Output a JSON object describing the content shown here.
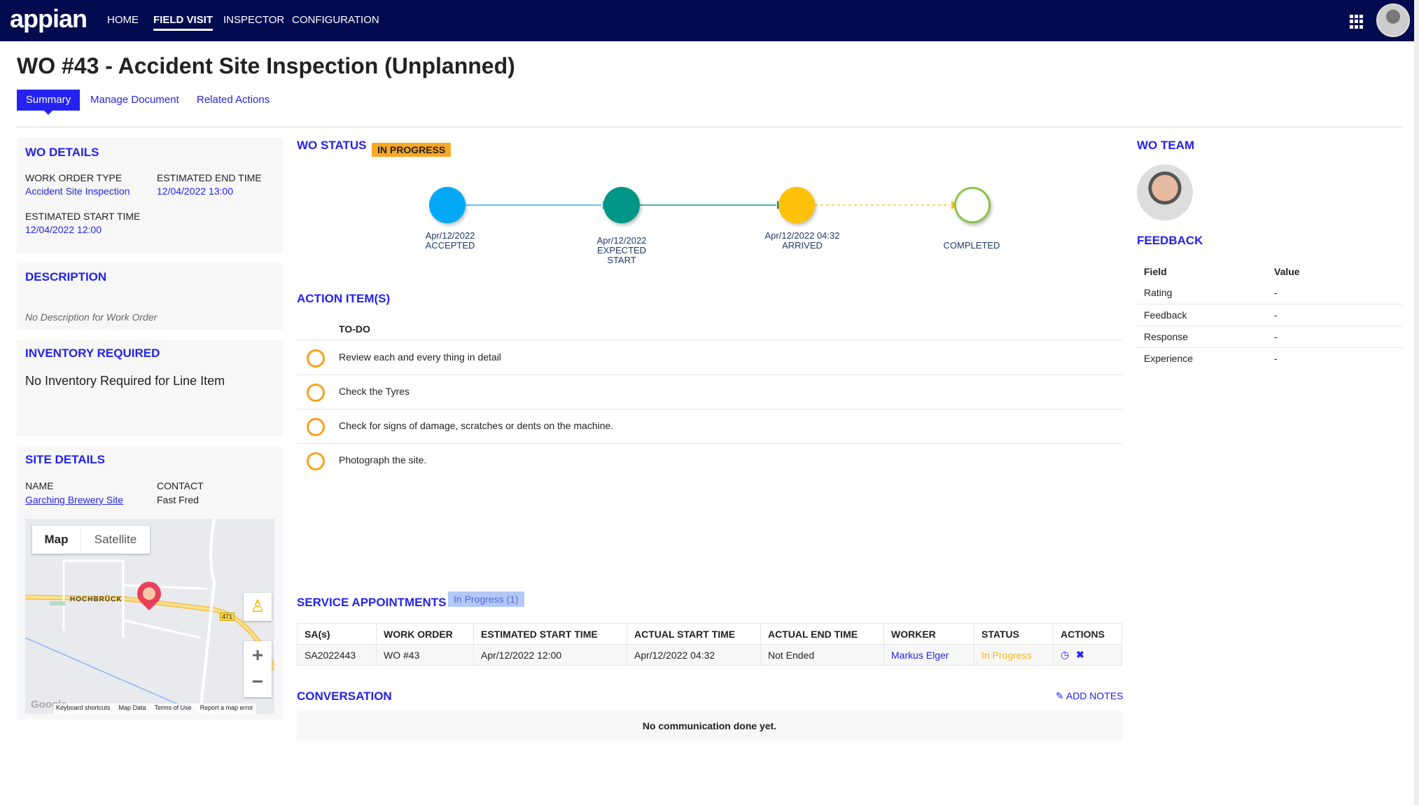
{
  "header": {
    "logo": "appian",
    "nav": [
      "HOME",
      "FIELD VISIT",
      "INSPECTOR",
      "CONFIGURATION"
    ],
    "active_nav": "FIELD VISIT"
  },
  "page": {
    "title": "WO #43 - Accident Site Inspection (Unplanned)",
    "tabs": [
      "Summary",
      "Manage Document",
      "Related Actions"
    ]
  },
  "wo_details": {
    "heading": "WO DETAILS",
    "work_order_type_label": "WORK ORDER TYPE",
    "work_order_type": "Accident Site Inspection",
    "est_end_label": "ESTIMATED END TIME",
    "est_end": "12/04/2022 13:00",
    "est_start_label": "ESTIMATED START TIME",
    "est_start": "12/04/2022 12:00"
  },
  "description": {
    "heading": "DESCRIPTION",
    "text": "No Description for Work Order"
  },
  "inventory": {
    "heading": "INVENTORY REQUIRED",
    "text": "No Inventory Required for Line Item"
  },
  "site": {
    "heading": "SITE DETAILS",
    "name_label": "NAME",
    "name": "Garching Brewery Site",
    "contact_label": "CONTACT",
    "contact": "Fast Fred",
    "map": {
      "map_btn": "Map",
      "satellite_btn": "Satellite",
      "place": "HOCHBRÜCK",
      "road": "471",
      "google": "Google",
      "footer": [
        "Keyboard shortcuts",
        "Map Data",
        "Terms of Use",
        "Report a map error"
      ]
    }
  },
  "status": {
    "heading": "WO STATUS",
    "badge": "IN PROGRESS",
    "badge_color": "#f9a825",
    "steps": [
      {
        "date": "Apr/12/2022",
        "label": "ACCEPTED",
        "color": "#03a9f4"
      },
      {
        "date": "Apr/12/2022",
        "label": "EXPECTED START",
        "color": "#009688"
      },
      {
        "date": "Apr/12/2022 04:32",
        "label": "ARRIVED",
        "color": "#ffc107"
      },
      {
        "date": "",
        "label": "COMPLETED",
        "color": "#ffffff"
      }
    ]
  },
  "actions": {
    "heading": "ACTION ITEM(S)",
    "column": "TO-DO",
    "items": [
      "Review each and every thing in detail",
      "Check the Tyres",
      "Check for signs of damage, scratches or dents on the machine.",
      "Photograph the site."
    ]
  },
  "service": {
    "heading": "SERVICE APPOINTMENTS",
    "badge": "In Progress (1)",
    "columns": [
      "SA(s)",
      "WORK ORDER",
      "ESTIMATED START TIME",
      "ACTUAL START TIME",
      "ACTUAL END TIME",
      "WORKER",
      "STATUS",
      "ACTIONS"
    ],
    "rows": [
      {
        "sa": "SA2022443",
        "wo": "WO #43",
        "est_start": "Apr/12/2022 12:00",
        "act_start": "Apr/12/2022 04:32",
        "act_end": "Not Ended",
        "worker": "Markus Elger",
        "status": "In Progress"
      }
    ]
  },
  "conversation": {
    "heading": "CONVERSATION",
    "add_notes": "ADD NOTES",
    "empty": "No communication done yet."
  },
  "team": {
    "heading": "WO TEAM"
  },
  "feedback": {
    "heading": "FEEDBACK",
    "columns": [
      "Field",
      "Value"
    ],
    "rows": [
      [
        "Rating",
        "-"
      ],
      [
        "Feedback",
        "-"
      ],
      [
        "Response",
        "-"
      ],
      [
        "Experience",
        "-"
      ]
    ]
  }
}
